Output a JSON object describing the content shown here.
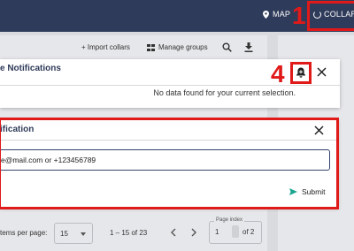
{
  "topnav": {
    "map_label": "MAP",
    "collars_label": "COLLARS"
  },
  "annotations": {
    "marker_1": "1",
    "marker_4": "4"
  },
  "toolbar": {
    "import_label": "+ Import collars",
    "manage_label": "Manage groups"
  },
  "notifications_dialog": {
    "title": "e Notifications",
    "empty_message": "No data found for your current selection."
  },
  "add_notification_dialog": {
    "title": "ification",
    "contact_value": "e@mail.com or +123456789",
    "submit_label": "Submit"
  },
  "pagination": {
    "items_per_page_label": "tems per page:",
    "items_per_page_value": "15",
    "range_text": "1 – 15 of 23",
    "page_index_label": "Page index",
    "page_index_value": "1",
    "page_of_text": "of 2"
  },
  "colors": {
    "topbar": "#2f3b5a",
    "annotation_red": "#e01919",
    "submit_green": "#1aa58f"
  }
}
